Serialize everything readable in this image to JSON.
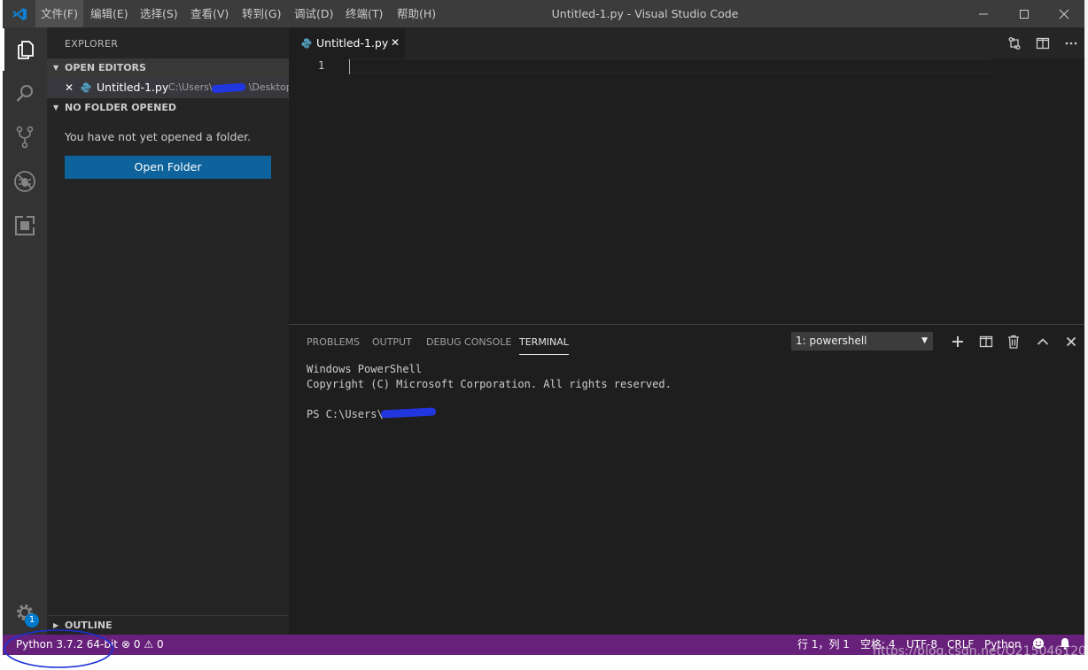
{
  "titlebar": {
    "title": "Untitled-1.py - Visual Studio Code",
    "menu": [
      "文件(F)",
      "编辑(E)",
      "选择(S)",
      "查看(V)",
      "转到(G)",
      "调试(D)",
      "终端(T)",
      "帮助(H)"
    ]
  },
  "sidebar": {
    "title": "EXPLORER",
    "open_editors": {
      "header": "OPEN EDITORS",
      "close_glyph": "✕",
      "file_name": "Untitled-1.py",
      "file_path": "C:\\Users\\",
      "file_path_tail": "\\Desktop"
    },
    "no_folder": {
      "header": "NO FOLDER OPENED",
      "message": "You have not yet opened a folder.",
      "button": "Open Folder"
    },
    "outline": {
      "header": "OUTLINE"
    }
  },
  "editor": {
    "tab_label": "Untitled-1.py",
    "tab_close": "✕",
    "line_number": "1"
  },
  "panel": {
    "tabs": [
      "PROBLEMS",
      "OUTPUT",
      "DEBUG CONSOLE",
      "TERMINAL"
    ],
    "terminal_select": "1: powershell",
    "terminal_lines": [
      "Windows PowerShell",
      "Copyright (C) Microsoft Corporation. All rights reserved.",
      "",
      "PS C:\\Users\\"
    ]
  },
  "activity": {
    "settings_badge": "1"
  },
  "statusbar": {
    "interpreter": "Python 3.7.2 64-bit",
    "errors": "0",
    "warnings": "0",
    "position": "行 1，列 1",
    "spaces": "空格: 4",
    "encoding": "UTF-8",
    "eol": "CRLF",
    "language": "Python"
  },
  "watermark": "https://blog.csdn.net/Q215046120",
  "colors": {
    "statusbar": "#68217a",
    "accent_button": "#0e639c",
    "annotation_ellipse": "#1a2fd6"
  }
}
